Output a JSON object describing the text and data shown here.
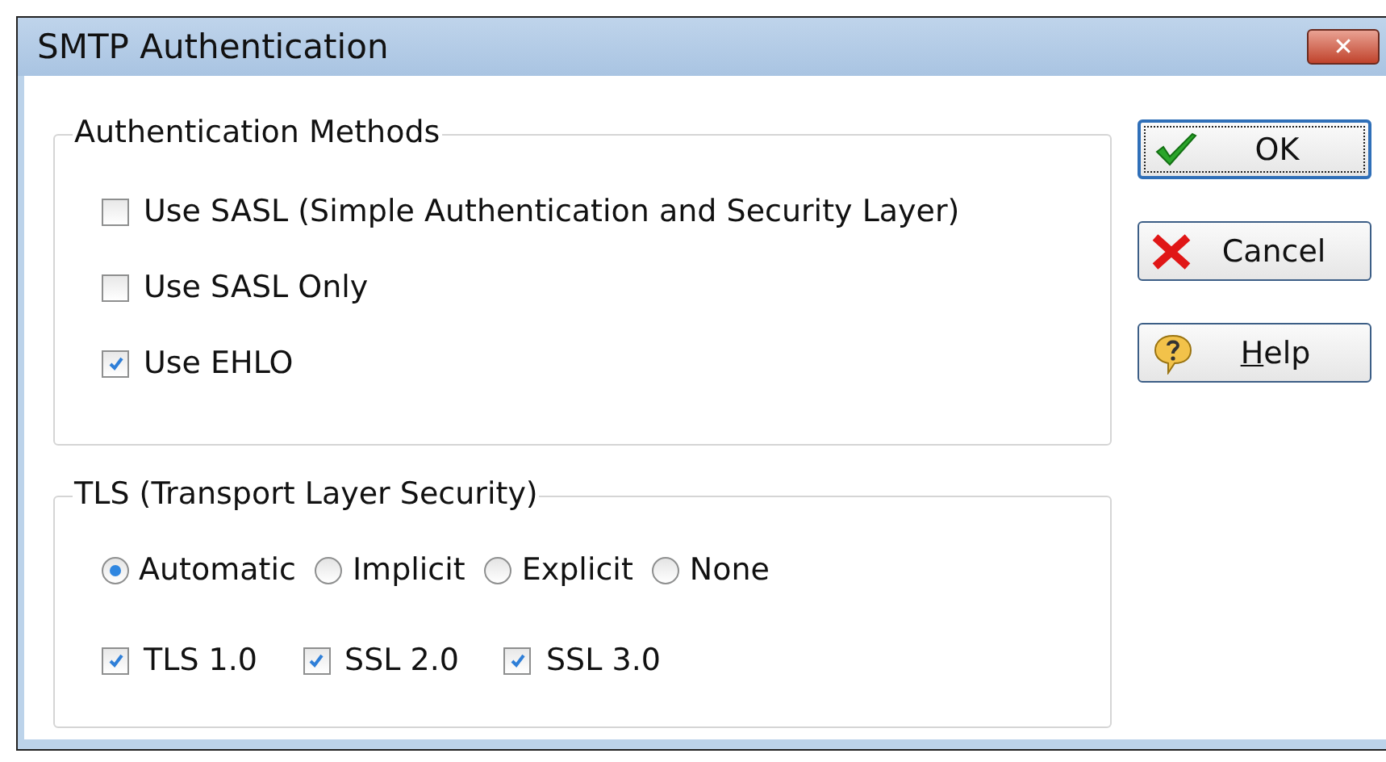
{
  "window": {
    "title": "SMTP Authentication",
    "close_symbol": "✕"
  },
  "auth_methods": {
    "legend": "Authentication Methods",
    "options": [
      {
        "label": "Use SASL (Simple Authentication and Security Layer)",
        "checked": false
      },
      {
        "label": "Use SASL Only",
        "checked": false
      },
      {
        "label": "Use EHLO",
        "checked": true
      }
    ]
  },
  "tls": {
    "legend": "TLS (Transport Layer Security)",
    "modes": [
      {
        "label": "Automatic",
        "selected": true
      },
      {
        "label": "Implicit",
        "selected": false
      },
      {
        "label": "Explicit",
        "selected": false
      },
      {
        "label": "None",
        "selected": false
      }
    ],
    "versions": [
      {
        "label": "TLS 1.0",
        "checked": true
      },
      {
        "label": "SSL 2.0",
        "checked": true
      },
      {
        "label": "SSL 3.0",
        "checked": true
      }
    ]
  },
  "buttons": [
    {
      "label": "OK",
      "kind": "ok",
      "focused": true,
      "mnemonic_first": false
    },
    {
      "label": "Cancel",
      "kind": "cancel",
      "focused": false,
      "mnemonic_first": false
    },
    {
      "label": "Help",
      "kind": "help",
      "focused": false,
      "mnemonic_first": true
    }
  ]
}
